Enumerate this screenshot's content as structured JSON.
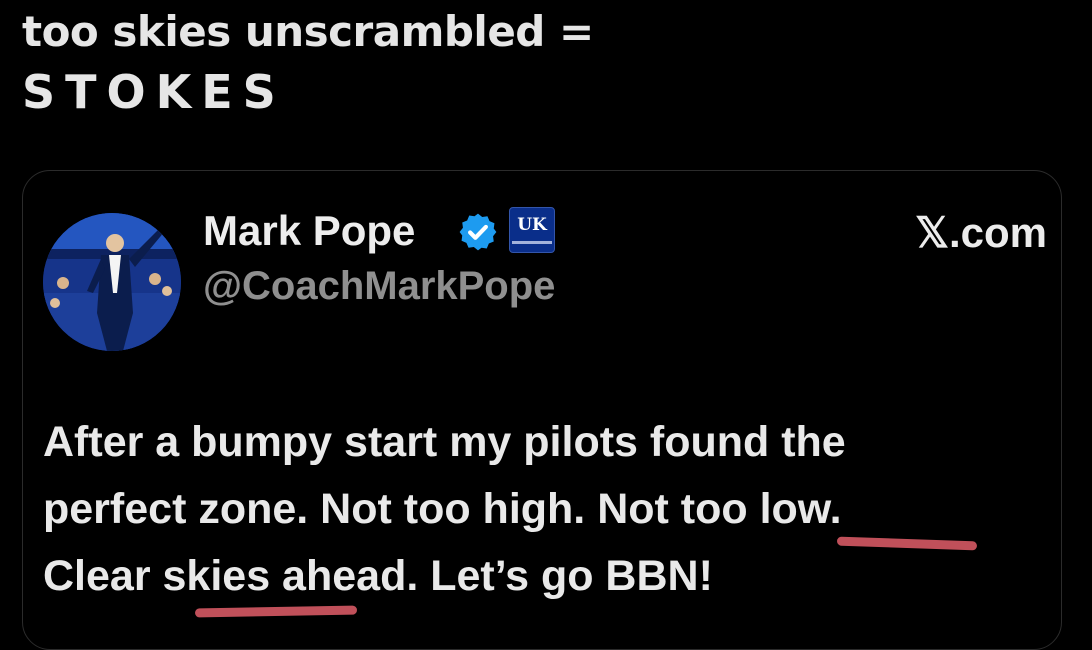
{
  "caption": {
    "line1": "too skies unscrambled =",
    "line2": "STOKES"
  },
  "tweet": {
    "author_name": "Mark Pope",
    "handle": "@CoachMarkPope",
    "source": "𝕏.com",
    "verified": true,
    "affiliate_badge_text": "UK",
    "body_lines": [
      "After a bumpy start my pilots found the",
      "perfect zone.  Not too high.  Not too low.",
      "Clear skies ahead.  Let’s go BBN!"
    ],
    "highlighted_words": [
      "too",
      "skies"
    ]
  },
  "colors": {
    "background": "#000000",
    "text": "#e9e9e9",
    "handle": "#8f8f8f",
    "verified": "#1d9bf0",
    "affiliate_bg": "#0a2e8a",
    "underline": "#c0505a",
    "card_border": "#2b2b2b"
  },
  "icons": {
    "verified": "verified-badge-icon",
    "affiliate": "kentucky-uk-logo-icon"
  }
}
